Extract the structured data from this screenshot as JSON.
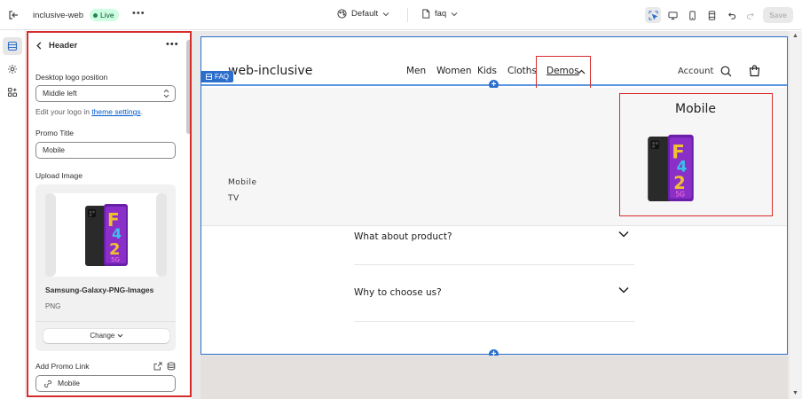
{
  "topbar": {
    "store_name": "inclusive-web",
    "status_badge": "Live",
    "theme_label": "Default",
    "page_label": "faq",
    "save_label": "Save"
  },
  "panel": {
    "title": "Header",
    "desktop_logo_position_label": "Desktop logo position",
    "desktop_logo_position_value": "Middle left",
    "help_text_prefix": "Edit your logo in ",
    "help_link": "theme settings",
    "help_text_suffix": ".",
    "promo_title_label": "Promo Title",
    "promo_title_value": "Mobile",
    "upload_image_label": "Upload Image",
    "file_name": "Samsung-Galaxy-PNG-Images",
    "file_type": "PNG",
    "change_button": "Change",
    "add_promo_link_label": "Add Promo Link",
    "promo_link_value": "Mobile"
  },
  "preview": {
    "logo": "web-inclusive",
    "nav": [
      "Men",
      "Women",
      "Kids",
      "Cloths",
      "Demos"
    ],
    "account": "Account",
    "section_tag": "FAQ",
    "mega_links": [
      "Mobile",
      "TV"
    ],
    "promo_title": "Mobile",
    "faq": [
      "What about product?",
      "Why to choose us?"
    ]
  },
  "colors": {
    "accent": "#2c6ecb",
    "highlight": "#d72c2c",
    "live_bg": "#cdfee1",
    "live_text": "#0c5132"
  }
}
